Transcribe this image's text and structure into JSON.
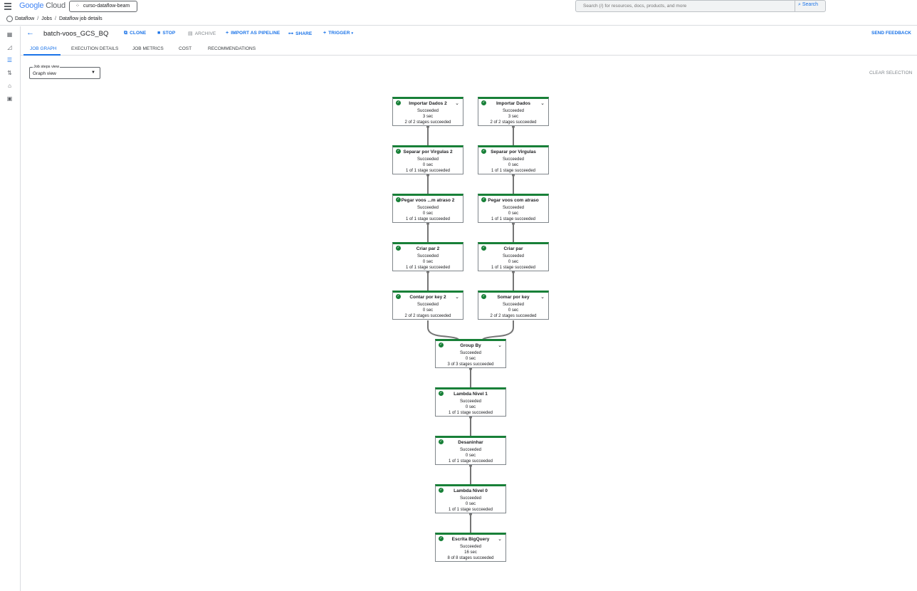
{
  "app": {
    "logo_google": "Google",
    "logo_cloud": "Cloud",
    "project": "curso-dataflow-beam",
    "search_placeholder": "Search (/) for resources, docs, products, and more",
    "search_button": "Search"
  },
  "breadcrumb": {
    "items": [
      "Dataflow",
      "Jobs",
      "Dataflow job details"
    ],
    "separator": "/"
  },
  "rail_icons": [
    "dashboard-icon",
    "chart-icon",
    "list-icon",
    "pipeline-icon",
    "workbench-icon",
    "snapshot-icon"
  ],
  "header": {
    "title": "batch-voos_GCS_BQ",
    "actions": {
      "clone": "CLONE",
      "stop": "STOP",
      "archive": "ARCHIVE",
      "import": "IMPORT AS PIPELINE",
      "share": "SHARE",
      "trigger": "TRIGGER"
    },
    "feedback": "SEND FEEDBACK"
  },
  "tabs": [
    "JOB GRAPH",
    "EXECUTION DETAILS",
    "JOB METRICS",
    "COST",
    "RECOMMENDATIONS"
  ],
  "steps_view": {
    "label": "Job steps view",
    "value": "Graph view"
  },
  "clear_selection": "CLEAR SELECTION",
  "colors": {
    "accent": "#1a73e8",
    "success": "#188038"
  },
  "nodes": {
    "n1": {
      "name": "Importar Dados 2",
      "status": "Succeeded",
      "time": "3 sec",
      "stages": "2 of 2 stages succeeded"
    },
    "n2": {
      "name": "Importar Dados",
      "status": "Succeeded",
      "time": "3 sec",
      "stages": "2 of 2 stages succeeded"
    },
    "n3": {
      "name": "Separar por Virgulas 2",
      "status": "Succeeded",
      "time": "0 sec",
      "stages": "1 of 1 stage succeeded"
    },
    "n4": {
      "name": "Separar por Virgulas",
      "status": "Succeeded",
      "time": "0 sec",
      "stages": "1 of 1 stage succeeded"
    },
    "n5": {
      "name": "Pegar voos ...m atraso 2",
      "status": "Succeeded",
      "time": "0 sec",
      "stages": "1 of 1 stage succeeded"
    },
    "n6": {
      "name": "Pegar voos com atraso",
      "status": "Succeeded",
      "time": "0 sec",
      "stages": "1 of 1 stage succeeded"
    },
    "n7": {
      "name": "Criar par 2",
      "status": "Succeeded",
      "time": "0 sec",
      "stages": "1 of 1 stage succeeded"
    },
    "n8": {
      "name": "Criar par",
      "status": "Succeeded",
      "time": "0 sec",
      "stages": "1 of 1 stage succeeded"
    },
    "n9": {
      "name": "Contar por key 2",
      "status": "Succeeded",
      "time": "0 sec",
      "stages": "2 of 2 stages succeeded"
    },
    "n10": {
      "name": "Somar por key",
      "status": "Succeeded",
      "time": "0 sec",
      "stages": "2 of 2 stages succeeded"
    },
    "n11": {
      "name": "Group By",
      "status": "Succeeded",
      "time": "0 sec",
      "stages": "3 of 3 stages succeeded"
    },
    "n12": {
      "name": "Lambda Nivel 1",
      "status": "Succeeded",
      "time": "0 sec",
      "stages": "1 of 1 stage succeeded"
    },
    "n13": {
      "name": "Desaninhar",
      "status": "Succeeded",
      "time": "0 sec",
      "stages": "1 of 1 stage succeeded"
    },
    "n14": {
      "name": "Lambda Nivel 0",
      "status": "Succeeded",
      "time": "0 sec",
      "stages": "1 of 1 stage succeeded"
    },
    "n15": {
      "name": "Escrita BigQuery",
      "status": "Succeeded",
      "time": "16 sec",
      "stages": "8 of 8 stages succeeded"
    }
  }
}
